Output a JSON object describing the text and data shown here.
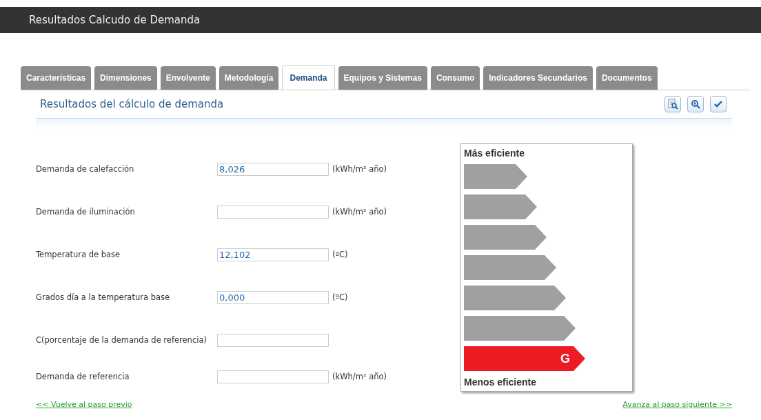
{
  "header": {
    "title": "Resultados Calcudo de Demanda"
  },
  "tabs": [
    {
      "label": "Características",
      "selected": false
    },
    {
      "label": "Dimensiones",
      "selected": false
    },
    {
      "label": "Envolvente",
      "selected": false
    },
    {
      "label": "Metodología",
      "selected": false
    },
    {
      "label": "Demanda",
      "selected": true
    },
    {
      "label": "Equipos y Sistemas",
      "selected": false
    },
    {
      "label": "Consumo",
      "selected": false
    },
    {
      "label": "Indicadores Secundarios",
      "selected": false
    },
    {
      "label": "Documentos",
      "selected": false
    }
  ],
  "section": {
    "title": "Resultados del cálculo de demanda"
  },
  "fields": [
    {
      "label": "Demanda de calefacción",
      "value": "8,026",
      "unit": "(kWh/m² año)"
    },
    {
      "label": "Demanda de iluminación",
      "unit": "(kWh/m² año)"
    },
    {
      "label": "Temperatura de base",
      "value": "12,102",
      "unit": "(ºC)"
    },
    {
      "label": "Grados día a la temperatura base",
      "value": "0,000",
      "unit": "(ºC)"
    },
    {
      "label": "C(porcentaje de la demanda de referencia)"
    },
    {
      "label": "Demanda de referencia",
      "unit": "(kWh/m² año)"
    }
  ],
  "rating": {
    "top_label": "Más eficiente",
    "bottom_label": "Menos eficiente",
    "classes": [
      {
        "selected": false
      },
      {
        "selected": false
      },
      {
        "selected": false
      },
      {
        "selected": false
      },
      {
        "selected": false
      },
      {
        "selected": false
      },
      {
        "selected": true,
        "label": "G"
      }
    ]
  },
  "links": {
    "previous": "<< Vuelve al paso previo",
    "next": "Avanza al paso siguiente >>"
  }
}
